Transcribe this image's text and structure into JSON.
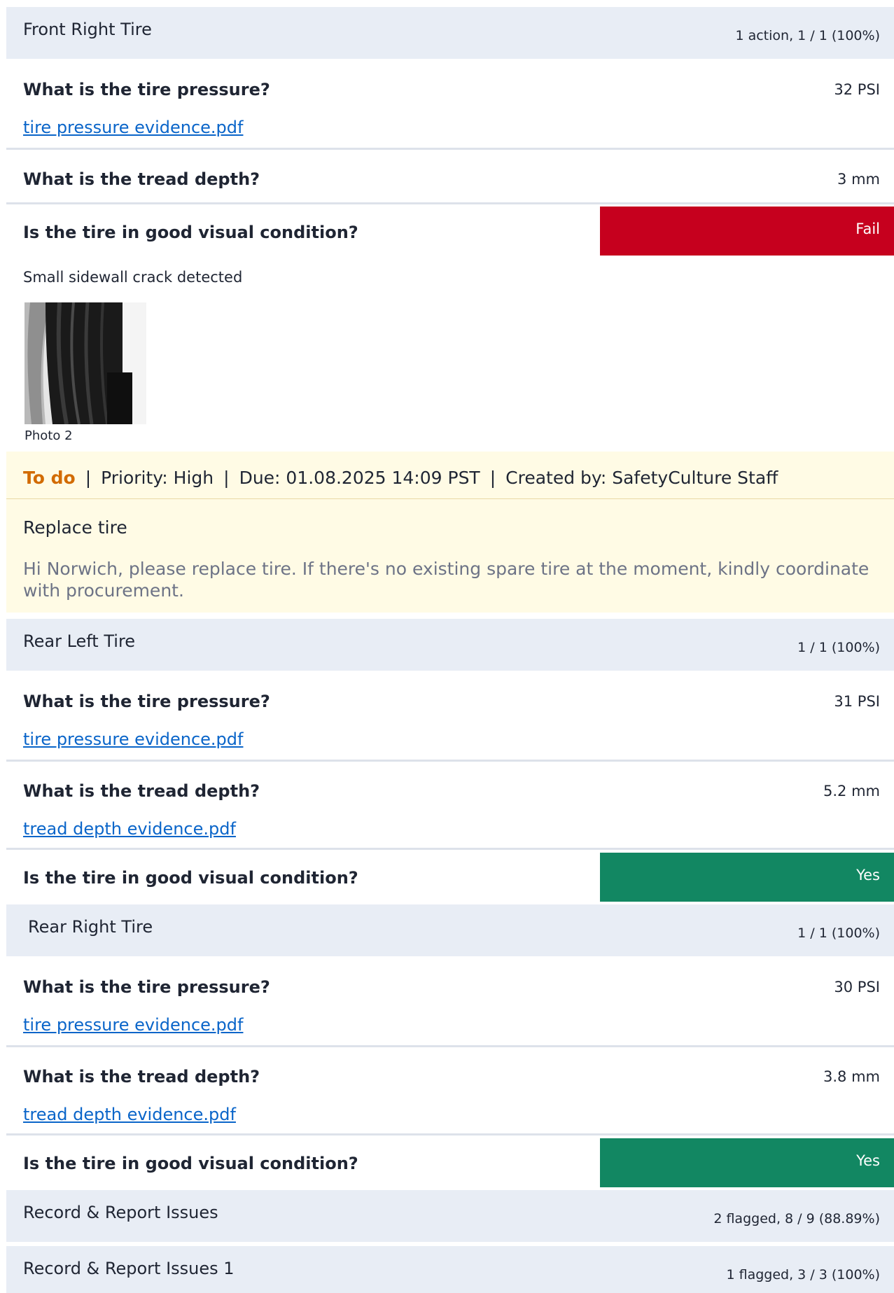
{
  "sections": {
    "front_right": {
      "title": "Front Right Tire",
      "meta": "1 action, 1 / 1 (100%)"
    },
    "rear_left": {
      "title": "Rear Left Tire",
      "meta": "1 / 1 (100%)"
    },
    "rear_right": {
      "title": "Rear Right Tire",
      "meta": "1 / 1 (100%)"
    },
    "record_issues": {
      "title": "Record & Report Issues",
      "meta": "2 flagged, 8 / 9 (88.89%)"
    },
    "record_issues_1": {
      "title": "Record & Report Issues 1",
      "meta": "1 flagged, 3 / 3 (100%)"
    }
  },
  "front_right": {
    "pressure_q": "What is the tire pressure?",
    "pressure_a": "32 PSI",
    "pressure_link": "tire pressure evidence.pdf",
    "tread_q": "What is the tread depth?",
    "tread_a": "3 mm",
    "visual_q": "Is the tire in good visual condition?",
    "visual_a": "Fail",
    "note": "Small sidewall crack detected",
    "photo_caption": "Photo 2"
  },
  "action": {
    "status": "To do",
    "priority": "Priority: High",
    "due": "Due: 01.08.2025 14:09 PST",
    "created_by": "Created by: SafetyCulture Staff",
    "separator": "|",
    "title": "Replace tire",
    "description": "Hi Norwich, please replace tire. If there's no existing spare tire at the moment, kindly coordinate with procurement."
  },
  "rear_left": {
    "pressure_q": "What is the tire pressure?",
    "pressure_a": "31 PSI",
    "pressure_link": "tire pressure evidence.pdf",
    "tread_q": "What is the tread depth?",
    "tread_a": "5.2 mm",
    "tread_link": "tread depth evidence.pdf",
    "visual_q": "Is the tire in good visual condition?",
    "visual_a": "Yes"
  },
  "rear_right": {
    "pressure_q": "What is the tire pressure?",
    "pressure_a": "30 PSI",
    "pressure_link": "tire pressure evidence.pdf",
    "tread_q": "What is the tread depth?",
    "tread_a": "3.8 mm",
    "tread_link": "tread depth evidence.pdf",
    "visual_q": "Is the tire in good visual condition?",
    "visual_a": "Yes"
  },
  "colors": {
    "fail": "#c6001e",
    "yes": "#128762",
    "link": "#0a65c9",
    "todo": "#d26b00"
  }
}
